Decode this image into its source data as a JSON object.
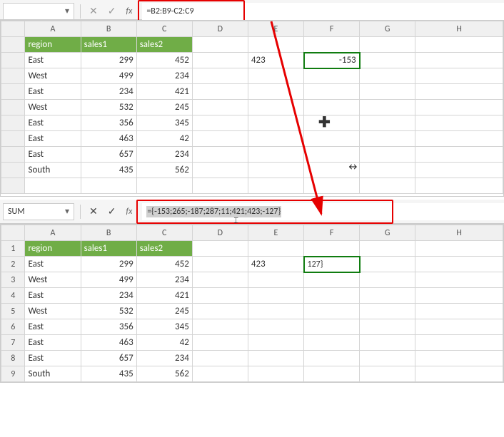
{
  "chart_data": {
    "type": "table",
    "headers": [
      "region",
      "sales1",
      "sales2"
    ],
    "rows": [
      [
        "East",
        299,
        452
      ],
      [
        "West",
        499,
        234
      ],
      [
        "East",
        234,
        421
      ],
      [
        "West",
        532,
        245
      ],
      [
        "East",
        356,
        345
      ],
      [
        "East",
        463,
        42
      ],
      [
        "East",
        657,
        234
      ],
      [
        "South",
        435,
        562
      ]
    ],
    "formula_top": "=B2:B9-C2:C9",
    "formula_bottom": "={-153;265;-187;287;11;421;423;-127}",
    "value_E2": "423",
    "value_F2_top": "-153",
    "value_F2_bottom": "127}"
  },
  "top": {
    "name_box": "",
    "fx": "fx",
    "formula": "=B2:B9-C2:C9",
    "cols": [
      "A",
      "B",
      "C",
      "D",
      "E",
      "F",
      "G",
      "H"
    ],
    "headers": {
      "A": "region",
      "B": "sales1",
      "C": "sales2"
    },
    "rows": [
      {
        "A": "East",
        "B": "299",
        "C": "452"
      },
      {
        "A": "West",
        "B": "499",
        "C": "234"
      },
      {
        "A": "East",
        "B": "234",
        "C": "421"
      },
      {
        "A": "West",
        "B": "532",
        "C": "245"
      },
      {
        "A": "East",
        "B": "356",
        "C": "345"
      },
      {
        "A": "East",
        "B": "463",
        "C": "42"
      },
      {
        "A": "East",
        "B": "657",
        "C": "234"
      },
      {
        "A": "South",
        "B": "435",
        "C": "562"
      }
    ],
    "E2": "423",
    "F2": "-153"
  },
  "bottom": {
    "name_box": "SUM",
    "fx": "fx",
    "formula": "={-153;265;-187;287;11;421;423;-127}",
    "cols": [
      "A",
      "B",
      "C",
      "D",
      "E",
      "F",
      "G",
      "H"
    ],
    "row_nums": [
      "1",
      "2",
      "3",
      "4",
      "5",
      "6",
      "7",
      "8",
      "9"
    ],
    "headers": {
      "A": "region",
      "B": "sales1",
      "C": "sales2"
    },
    "rows": [
      {
        "A": "East",
        "B": "299",
        "C": "452"
      },
      {
        "A": "West",
        "B": "499",
        "C": "234"
      },
      {
        "A": "East",
        "B": "234",
        "C": "421"
      },
      {
        "A": "West",
        "B": "532",
        "C": "245"
      },
      {
        "A": "East",
        "B": "356",
        "C": "345"
      },
      {
        "A": "East",
        "B": "463",
        "C": "42"
      },
      {
        "A": "East",
        "B": "657",
        "C": "234"
      },
      {
        "A": "South",
        "B": "435",
        "C": "562"
      }
    ],
    "E2": "423",
    "F2": "127}"
  },
  "icons": {
    "x": "✕",
    "check": "✓",
    "dd": "▾",
    "plus": "✚",
    "resize": "↔"
  }
}
